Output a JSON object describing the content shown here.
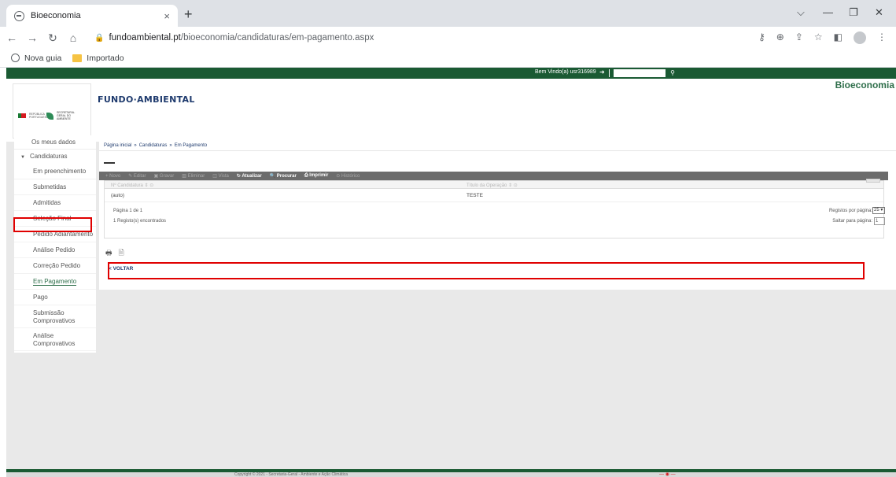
{
  "browser": {
    "tab_title": "Bioeconomia",
    "tab_close": "×",
    "new_tab": "+",
    "url_host": "fundoambiental.pt",
    "url_path": "/bioeconomia/candidaturas/em-pagamento.aspx",
    "bookmarks": [
      "Nova guia",
      "Importado"
    ],
    "window_controls": [
      "⌵",
      "—",
      "❐",
      "✕"
    ]
  },
  "topbar": {
    "welcome": "Bem Vindo(a) usr316989",
    "search_value": ""
  },
  "header": {
    "gov_text": "REPÚBLICA PORTUGUESA",
    "secretaria": "SECRETARIA-GERAL DO AMBIENTE",
    "brand": "FUNDO·AMBIENTAL",
    "section": "Bioeconomia"
  },
  "sidebar": {
    "top_item": "Os meus dados",
    "group": "Candidaturas",
    "items": [
      "Em preenchimento",
      "Submetidas",
      "Admitidas",
      "Seleção Final",
      "Pedido Adiantamento",
      "Análise Pedido",
      "Correção Pedido",
      "Em Pagamento",
      "Pago",
      "Submissão Comprovativos",
      "Análise Comprovativos"
    ]
  },
  "breadcrumb": [
    "Página inicial",
    "Candidaturas",
    "Em Pagamento"
  ],
  "toolbar": {
    "novo": "+ Novo",
    "editar": "✎ Editar",
    "gravar": "▣ Gravar",
    "eliminar": "▥ Eliminar",
    "vista": "◫ Vista",
    "atualizar": "↻ Atualizar",
    "procurar": "🔍 Procurar",
    "imprimir": "⎙ Imprimir",
    "historico": "⊙ Histórico"
  },
  "grid": {
    "columns": [
      "Nº Candidatura ⇕ ⊙",
      "Título da Operação ⇕ ⊙"
    ],
    "rows": [
      [
        "(auto)",
        "TESTE"
      ]
    ]
  },
  "pager": {
    "page_info": "Página 1 de 1",
    "records": "1 Registo(s) encontrados",
    "per_page_label": "Registos por página:",
    "per_page_value": "25",
    "goto_label": "Saltar para página:",
    "goto_value": "1"
  },
  "voltar": "< VOLTAR",
  "footer": {
    "text": "Copyright © 2021 - Secretaria-Geral - Ambiente e Ação Climática",
    "brand": "— ◉ —"
  },
  "colors": {
    "green": "#1a5a33",
    "highlight": "#e00000",
    "brand_blue": "#1f3b6e"
  }
}
